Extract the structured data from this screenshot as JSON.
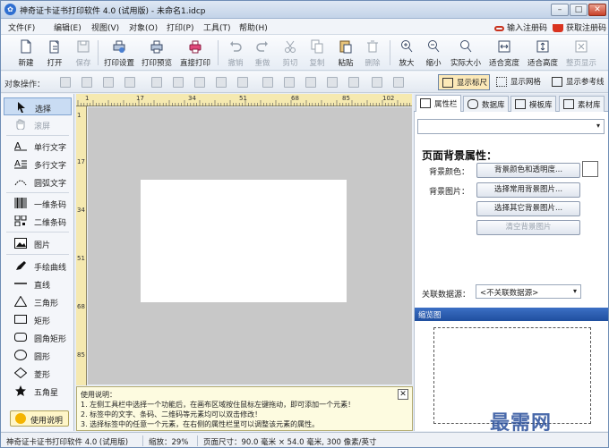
{
  "window": {
    "title": "神奇证卡证书打印软件 4.0 (试用版) - 未命名1.idcp",
    "app_icon_glyph": "✿"
  },
  "menu": [
    "文件(F)",
    "编辑(E)",
    "视图(V)",
    "对象(O)",
    "打印(P)",
    "工具(T)",
    "帮助(H)"
  ],
  "menu_right": {
    "register": "输入注册码",
    "buy": "获取注册码"
  },
  "toolbar": {
    "buttons": [
      {
        "label": "新建"
      },
      {
        "label": "打开"
      },
      {
        "label": "保存"
      },
      {
        "label": "打印设置"
      },
      {
        "label": "打印预览"
      },
      {
        "label": "直接打印"
      },
      {
        "label": "撤销"
      },
      {
        "label": "重做"
      },
      {
        "label": "剪切"
      },
      {
        "label": "复制"
      },
      {
        "label": "粘贴"
      },
      {
        "label": "删除"
      },
      {
        "label": "放大"
      },
      {
        "label": "缩小"
      },
      {
        "label": "实际大小"
      },
      {
        "label": "适合宽度"
      },
      {
        "label": "适合高度"
      },
      {
        "label": "整页显示"
      }
    ]
  },
  "objbar": {
    "label": "对象操作：",
    "toggles": [
      {
        "label": "显示标尺"
      },
      {
        "label": "显示网格"
      },
      {
        "label": "显示参考线"
      }
    ]
  },
  "tools": [
    {
      "label": "选择"
    },
    {
      "label": "滚屏"
    },
    {
      "label": "单行文字"
    },
    {
      "label": "多行文字"
    },
    {
      "label": "圆弧文字"
    },
    {
      "label": "一维条码"
    },
    {
      "label": "二维条码"
    },
    {
      "label": "图片"
    },
    {
      "label": "手绘曲线"
    },
    {
      "label": "直线"
    },
    {
      "label": "三角形"
    },
    {
      "label": "矩形"
    },
    {
      "label": "圆角矩形"
    },
    {
      "label": "圆形"
    },
    {
      "label": "菱形"
    },
    {
      "label": "五角星"
    }
  ],
  "help_button": "使用说明",
  "ruler": {
    "marks": [
      "1",
      "17",
      "34",
      "51",
      "68",
      "85",
      "102"
    ],
    "vmarks": [
      "1",
      "17",
      "34",
      "51",
      "68",
      "85"
    ]
  },
  "help_note": {
    "title": "使用说明：",
    "lines": [
      "1. 左侧工具栏中选择一个功能后，在画布区域按住鼠标左键拖动，即可添加一个元素！",
      "2. 标签中的文字、条码、二维码等元素均可以双击修改！",
      "3. 选择标签中的任意一个元素，在右侧的属性栏里可以调整该元素的属性。"
    ],
    "close": "✕"
  },
  "tabs": [
    {
      "label": "属性栏"
    },
    {
      "label": "数据库"
    },
    {
      "label": "模板库"
    },
    {
      "label": "素材库"
    }
  ],
  "properties": {
    "select_arrow": "▾",
    "title": "页面背景属性：",
    "bg_color_label": "背景颜色：",
    "bg_color_btn": "背景颜色和透明度...",
    "bg_image_label": "背景图片：",
    "btn_common_bg": "选择常用背景图片...",
    "btn_other_bg": "选择其它背景图片...",
    "btn_clear_bg": "清空背景图片",
    "rel_db_label": "关联数据源：",
    "rel_db_value": "<不关联数据源>"
  },
  "preview_title": "缩览图",
  "status": {
    "app": "神奇证卡证书打印软件 4.0 (试用版)",
    "zoom": "缩放：29%",
    "page_size": "页面尺寸：90.0 毫米 × 54.0 毫米, 300 像素/英寸"
  },
  "watermark": "最需网"
}
